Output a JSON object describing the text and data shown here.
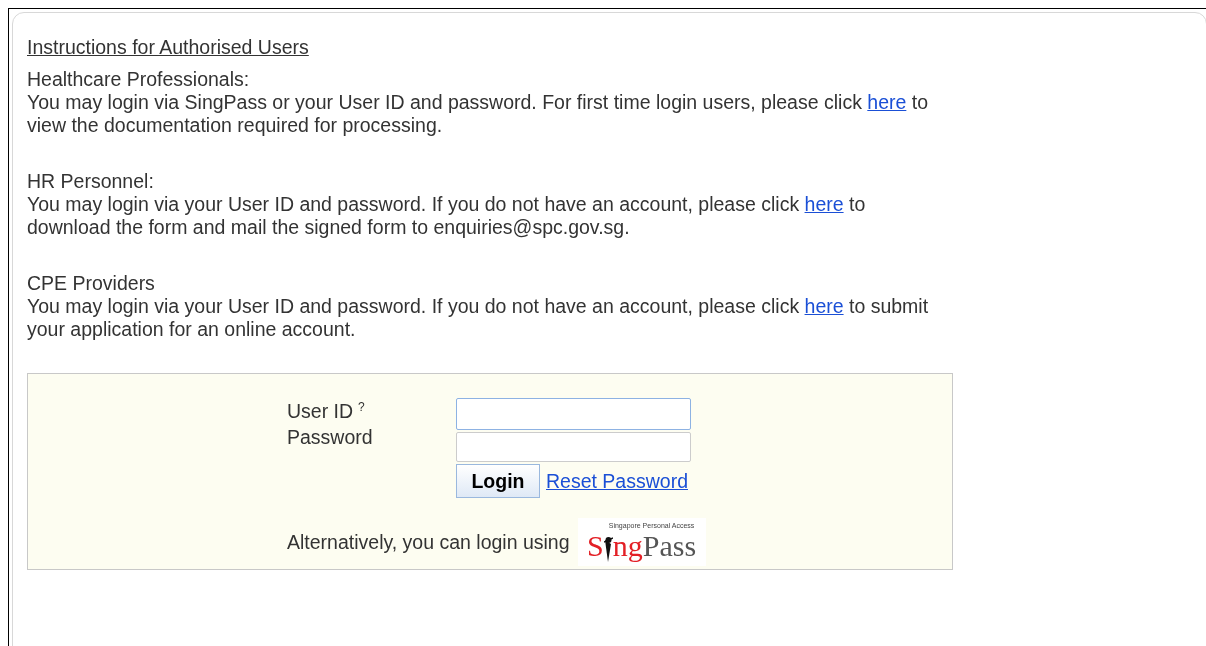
{
  "title": "Instructions for Authorised Users",
  "sections": [
    {
      "heading": "Healthcare Professionals:",
      "text_before": "You may login via SingPass or your User ID and password. For first time login users, please click",
      "link": "here",
      "text_after": "to view the documentation required for processing."
    },
    {
      "heading": "HR Personnel:",
      "text_before": "You may login via your User ID and password. If you do not have an account, please click",
      "link": "here",
      "text_after": "to download the form and mail the signed form to enquiries@spc.gov.sg."
    },
    {
      "heading": "CPE Providers",
      "text_before": "You may login via your User ID and password. If you do not have an account, please click",
      "link": "here",
      "text_after": "to submit your application for an online account."
    }
  ],
  "login": {
    "user_id_label": "User ID",
    "help_mark": "?",
    "password_label": "Password",
    "login_button": "Login",
    "reset_link": "Reset Password",
    "alternative_text": "Alternatively, you can login using",
    "logo": {
      "tagline": "Singapore Personal Access",
      "part_1": "S",
      "part_2": "ng",
      "part_3": "Pass"
    }
  }
}
